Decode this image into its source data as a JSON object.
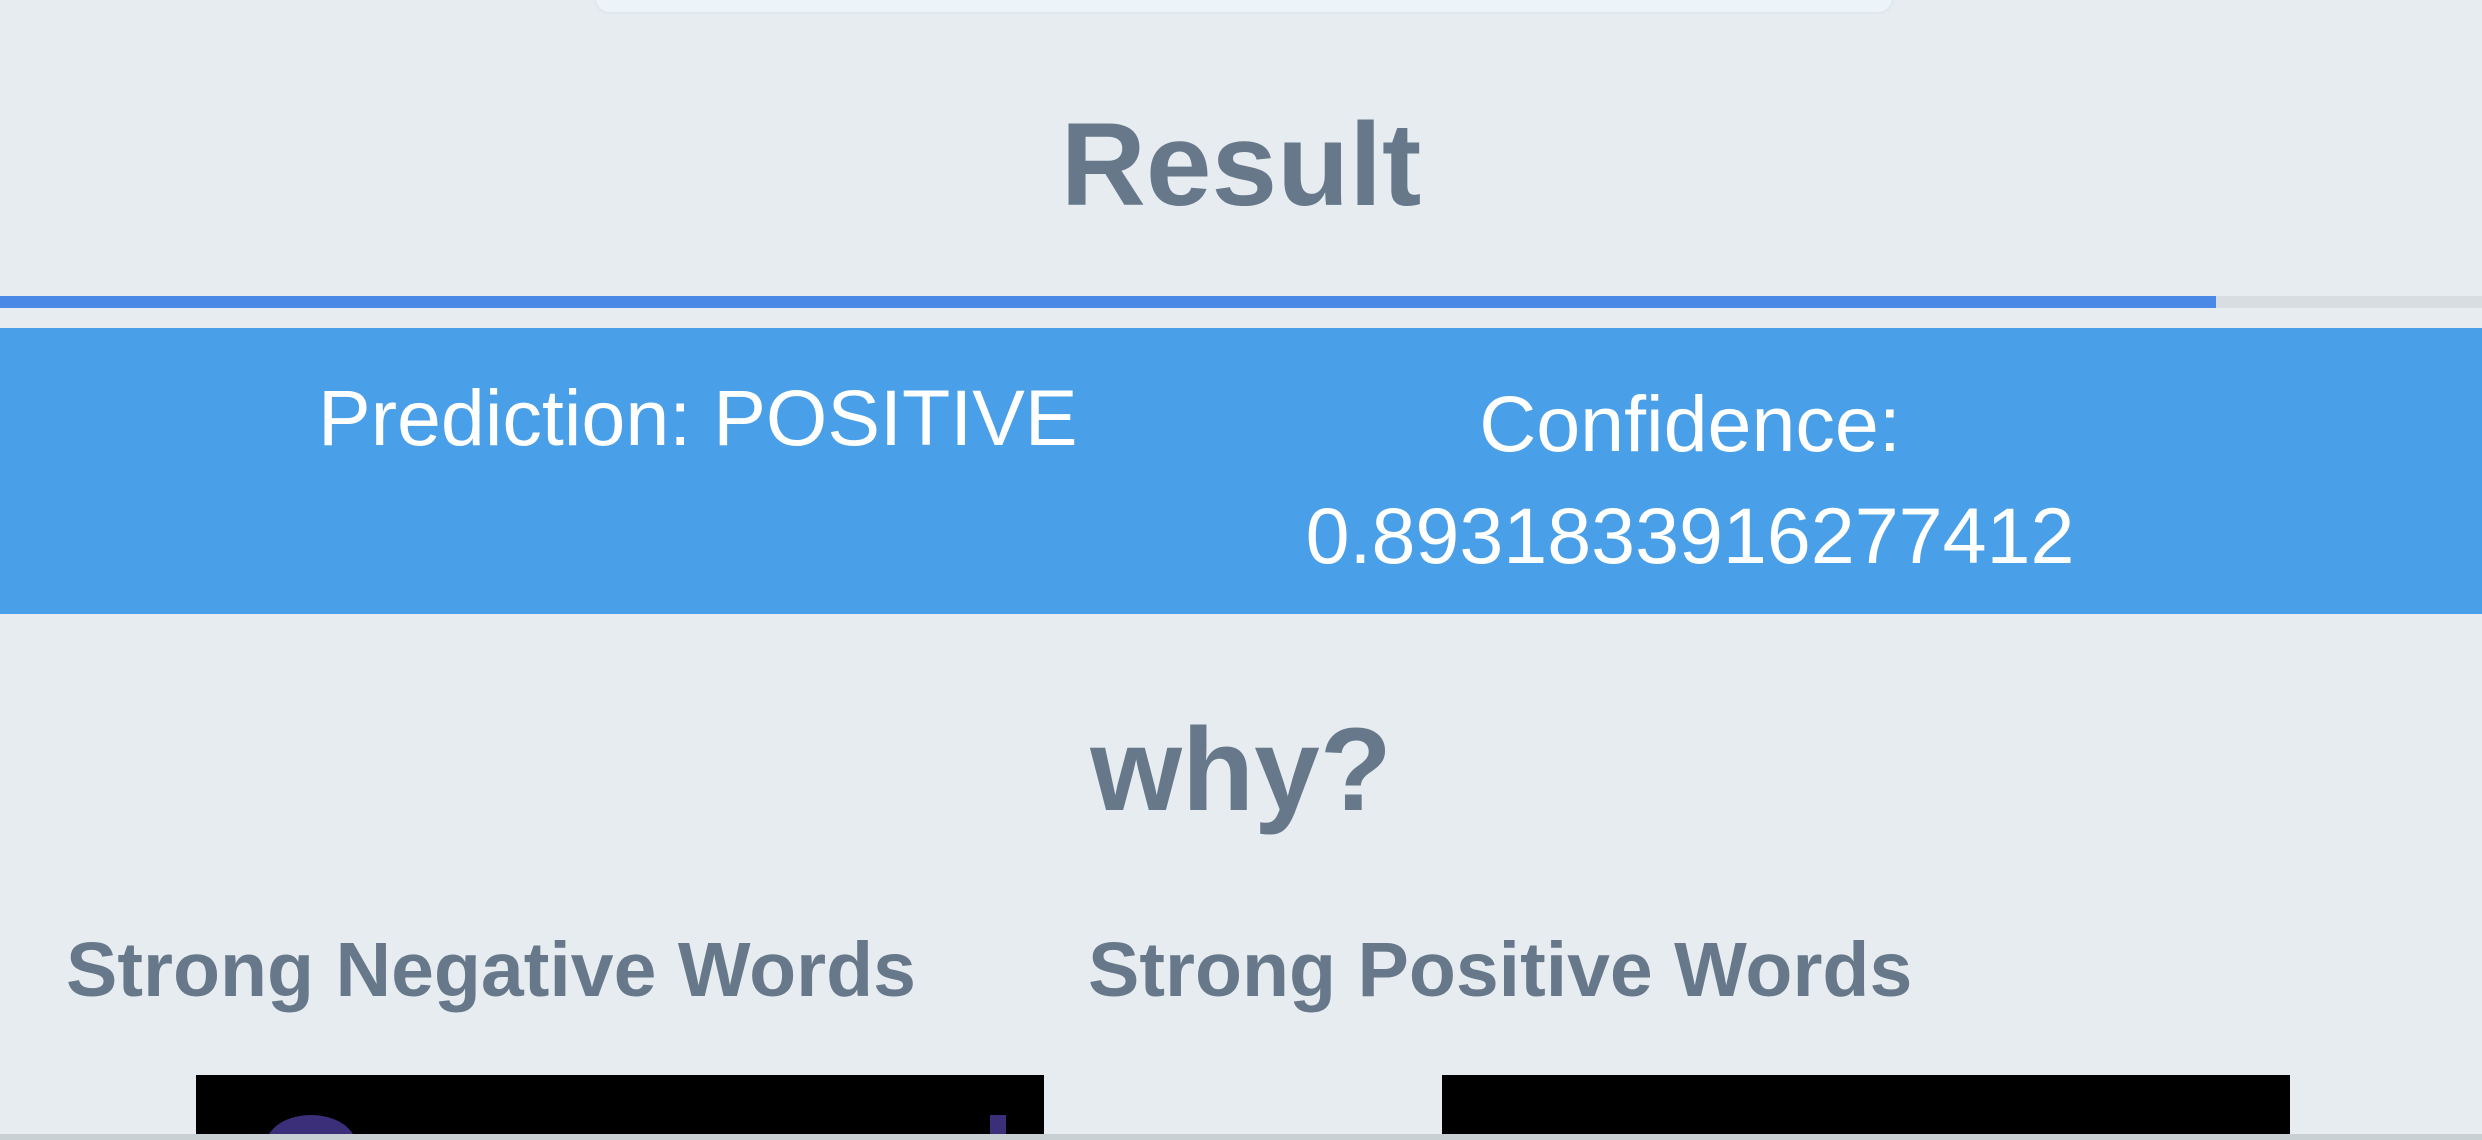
{
  "result": {
    "title": "Result",
    "progress_fraction": 0.893
  },
  "prediction": {
    "label": "Prediction: POSITIVE",
    "confidence_label": "Confidence:",
    "confidence_value": "0.8931833916277412"
  },
  "explanation": {
    "title": "why?",
    "negative_heading": "Strong Negative Words",
    "positive_heading": "Strong Positive Words"
  },
  "colors": {
    "background": "#e6ecef",
    "heading_text": "#66788a",
    "progress_fill": "#4a8ae6",
    "banner": "#4aa0e8",
    "banner_text": "#ffffff",
    "wordcloud_bg": "#000000"
  }
}
